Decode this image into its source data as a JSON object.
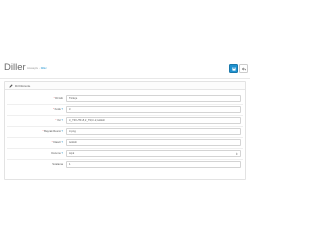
{
  "header": {
    "title": "Diller",
    "breadcrumb": [
      "Anasayfa",
      "Diller"
    ]
  },
  "toolbar": {
    "save_icon": "save-icon",
    "cancel_icon": "reply-icon",
    "accent_color": "#1e91cf"
  },
  "panel": {
    "title": "Dil Düzenle",
    "icon": "pencil-icon"
  },
  "form": {
    "fields": [
      {
        "label": "Dil Adı",
        "required": true,
        "hint": false,
        "value": "Türkçe",
        "type": "text"
      },
      {
        "label": "Kodu",
        "required": true,
        "hint": true,
        "value": "tr",
        "type": "text"
      },
      {
        "label": "Yer",
        "required": true,
        "hint": true,
        "value": "tr_TR.UTF-8,tr_TR,tr-tr,turkish",
        "type": "text"
      },
      {
        "label": "Bayrak Resmi",
        "required": true,
        "hint": true,
        "value": "tr.png",
        "type": "text"
      },
      {
        "label": "Klasör",
        "required": true,
        "hint": true,
        "value": "turkish",
        "type": "text"
      },
      {
        "label": "Durumu",
        "required": false,
        "hint": true,
        "value": "Açık",
        "type": "select"
      },
      {
        "label": "Sıralama",
        "required": false,
        "hint": false,
        "value": "1",
        "type": "text"
      }
    ]
  }
}
